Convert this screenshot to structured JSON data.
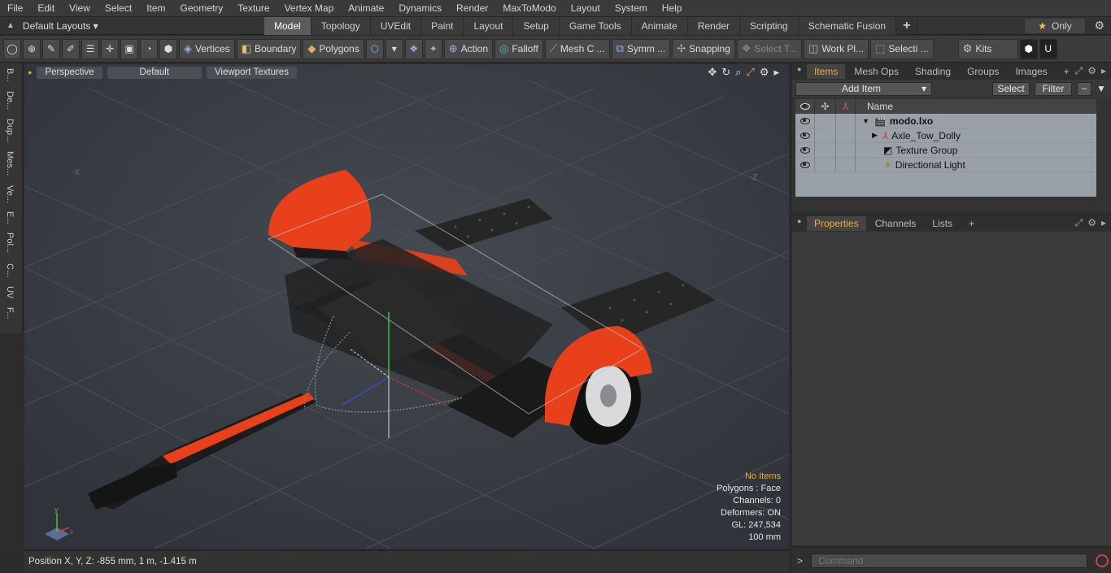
{
  "menu": [
    "File",
    "Edit",
    "View",
    "Select",
    "Item",
    "Geometry",
    "Texture",
    "Vertex Map",
    "Animate",
    "Dynamics",
    "Render",
    "MaxToModo",
    "Layout",
    "System",
    "Help"
  ],
  "layouts": {
    "label": "Default Layouts ▾"
  },
  "mode_tabs": [
    "Model",
    "Topology",
    "UVEdit",
    "Paint",
    "Layout",
    "Setup",
    "Game Tools",
    "Animate",
    "Render",
    "Scripting",
    "Schematic Fusion"
  ],
  "only_label": "Only",
  "toolbar": {
    "vertices": "Vertices",
    "boundary": "Boundary",
    "polygons": "Polygons",
    "action": "Action",
    "falloff": "Falloff",
    "meshc": "Mesh C ...",
    "symm": "Symm ...",
    "snapping": "Snapping",
    "selectt": "Select T...",
    "workpl": "Work Pl...",
    "selecti": "Selecti ...",
    "kits": "Kits"
  },
  "left_strip": [
    "B...",
    "De...",
    "Dup...",
    "Mes...",
    "Ve...",
    "E...",
    "Pol...",
    "C...",
    "UV",
    "F..."
  ],
  "viewport": {
    "perspective": "Perspective",
    "default": "Default",
    "textures": "Viewport Textures",
    "axis_x": "-X",
    "axis_z": "-Z"
  },
  "info": {
    "items": "No Items",
    "polygons": "Polygons : Face",
    "channels": "Channels: 0",
    "deformers": "Deformers: ON",
    "gl": "GL: 247,534",
    "scale": "100 mm"
  },
  "status": {
    "position": "Position X, Y, Z:  -855 mm, 1 m, -1.415 m"
  },
  "items_panel": {
    "tabs": [
      "Items",
      "Mesh Ops",
      "Shading",
      "Groups",
      "Images"
    ],
    "add_item": "Add Item",
    "select": "Select",
    "filter": "Filter",
    "name_header": "Name",
    "rows": [
      {
        "name": "modo.lxo",
        "indent": 0
      },
      {
        "name": "Axle_Tow_Dolly",
        "indent": 1
      },
      {
        "name": "Texture Group",
        "indent": 1
      },
      {
        "name": "Directional Light",
        "indent": 1
      }
    ]
  },
  "props_panel": {
    "tabs": [
      "Properties",
      "Channels",
      "Lists"
    ]
  },
  "command": {
    "placeholder": "Command"
  },
  "colors": {
    "orange": "#e8401a",
    "accent": "#f0a838"
  }
}
